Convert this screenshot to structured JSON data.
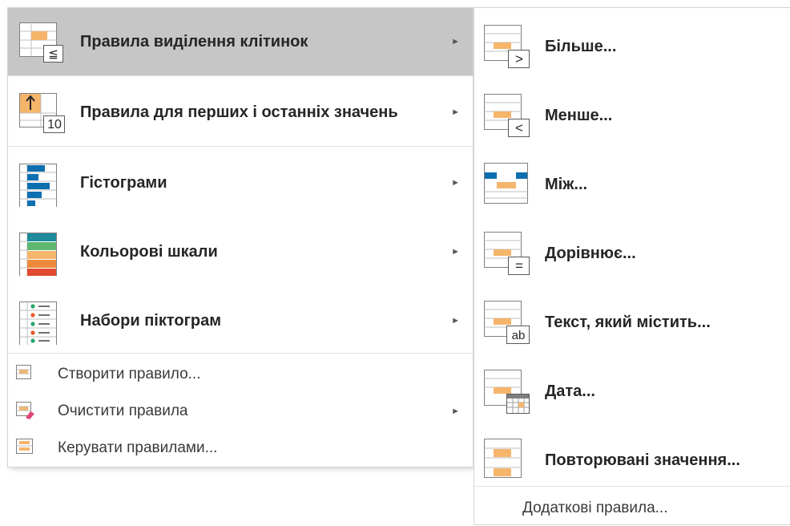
{
  "colors": {
    "highlight": "#c6c6c6",
    "orange": "#f5b56b",
    "blue": "#0e6fb0",
    "text": "#262626"
  },
  "main_menu": {
    "items": [
      {
        "label": "Правила виділення клітинок",
        "icon": "highlight-cells-icon",
        "active": true,
        "has_submenu": true
      },
      {
        "label": "Правила для перших і останніх значень",
        "icon": "top-bottom-icon",
        "has_submenu": true
      },
      {
        "label": "Гістограми",
        "icon": "data-bars-icon",
        "has_submenu": true
      },
      {
        "label": "Кольорові шкали",
        "icon": "color-scales-icon",
        "has_submenu": true
      },
      {
        "label": "Набори піктограм",
        "icon": "icon-sets-icon",
        "has_submenu": true
      }
    ],
    "small_items": [
      {
        "label": "Створити правило...",
        "icon": "new-rule-icon",
        "has_submenu": false
      },
      {
        "label": "Очистити правила",
        "icon": "clear-rules-icon",
        "has_submenu": true
      },
      {
        "label": "Керувати правилами...",
        "icon": "manage-rules-icon",
        "has_submenu": false
      }
    ],
    "top_bottom_badge": "10",
    "arrow_glyph": "►"
  },
  "submenu": {
    "items": [
      {
        "label": "Більше...",
        "icon": "greater-than-icon",
        "badge": ">"
      },
      {
        "label": "Менше...",
        "icon": "less-than-icon",
        "badge": "<"
      },
      {
        "label": "Між...",
        "icon": "between-icon"
      },
      {
        "label": "Дорівнює...",
        "icon": "equal-to-icon",
        "badge": "="
      },
      {
        "label": "Текст, який містить...",
        "icon": "text-contains-icon",
        "badge": "ab"
      },
      {
        "label": "Дата...",
        "icon": "date-occurring-icon"
      },
      {
        "label": "Повторювані значення...",
        "icon": "duplicate-values-icon"
      }
    ],
    "more_rules": "Додаткові правила..."
  }
}
